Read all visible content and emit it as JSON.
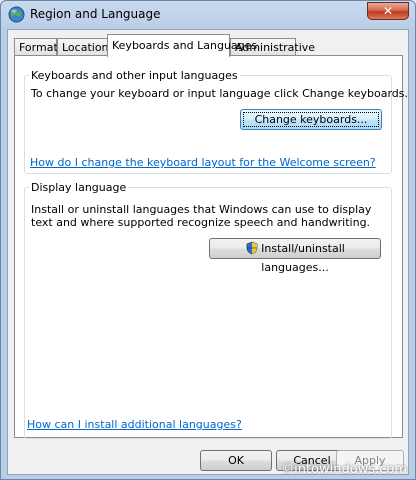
{
  "window": {
    "title": "Region and Language",
    "close_glyph": "✕"
  },
  "tabs": [
    {
      "label": "Formats"
    },
    {
      "label": "Location"
    },
    {
      "label": "Keyboards and Languages"
    },
    {
      "label": "Administrative"
    }
  ],
  "active_tab": "Keyboards and Languages",
  "keyboards_group": {
    "title": "Keyboards and other input languages",
    "description": "To change your keyboard or input language click Change keyboards.",
    "button_label": "Change keyboards...",
    "link": "How do I change the keyboard layout for the Welcome screen?"
  },
  "display_group": {
    "title": "Display language",
    "description": "Install or uninstall languages that Windows can use to display text and where supported recognize speech and handwriting.",
    "button_label": "Install/uninstall languages..."
  },
  "bottom_link": "How can I install additional languages?",
  "footer": {
    "ok_label": "OK",
    "cancel_label": "Cancel",
    "apply_label": "Apply"
  },
  "watermark": "©intowindows.com",
  "icons": {
    "app": "globe-icon",
    "install": "shield-icon"
  }
}
